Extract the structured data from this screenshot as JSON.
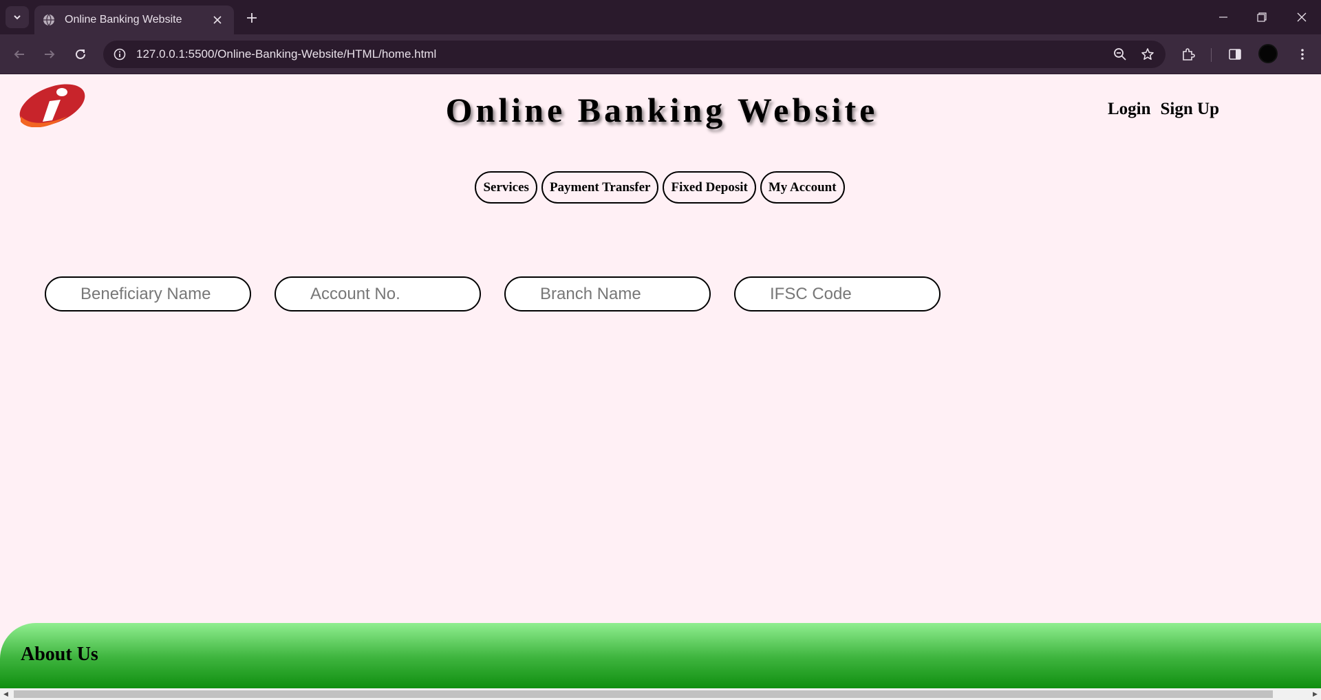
{
  "browser": {
    "tab_title": "Online Banking Website",
    "url": "127.0.0.1:5500/Online-Banking-Website/HTML/home.html"
  },
  "header": {
    "title": "Online Banking Website",
    "login_label": "Login",
    "signup_label": "Sign Up"
  },
  "nav": {
    "items": [
      {
        "label": "Services"
      },
      {
        "label": "Payment Transfer"
      },
      {
        "label": "Fixed Deposit"
      },
      {
        "label": "My Account"
      }
    ]
  },
  "form": {
    "beneficiary_placeholder": "Beneficiary Name",
    "account_placeholder": "Account No.",
    "branch_placeholder": "Branch Name",
    "ifsc_placeholder": "IFSC Code"
  },
  "footer": {
    "title": "About Us"
  },
  "colors": {
    "page_bg": "#fff0f5",
    "footer_light": "#90ee90",
    "footer_dark": "#0a8a0a",
    "logo_red": "#c8242b",
    "logo_orange": "#f26522"
  },
  "icons": {
    "tab_search": "chevron-down-icon",
    "favicon": "globe-icon",
    "tab_close": "close-icon",
    "new_tab": "plus-icon",
    "back": "arrow-left-icon",
    "forward": "arrow-right-icon",
    "reload": "reload-icon",
    "site_info": "info-icon",
    "zoom": "zoom-out-icon",
    "bookmark": "star-icon",
    "extensions": "puzzle-icon",
    "side_panel": "side-panel-icon",
    "menu": "kebab-menu-icon"
  }
}
